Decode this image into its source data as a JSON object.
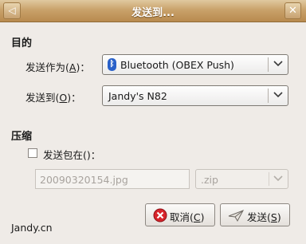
{
  "window": {
    "title": "发送到..."
  },
  "destination": {
    "section_title": "目的",
    "send_as_label_pre": "发送作为(",
    "send_as_mnemonic": "A",
    "send_as_label_post": ")：",
    "send_as_value": "Bluetooth (OBEX Push)",
    "send_to_label_pre": "发送到(",
    "send_to_mnemonic": "O",
    "send_to_label_post": ")：",
    "send_to_value": "Jandy's N82"
  },
  "compression": {
    "section_title": "压缩",
    "pack_label": "发送包在()：",
    "pack_checked": false,
    "filename_value": "20090320154.jpg",
    "format_value": ".zip"
  },
  "buttons": {
    "cancel_pre": "取消(",
    "cancel_mnemonic": "C",
    "cancel_post": ")",
    "send_pre": "发送(",
    "send_mnemonic": "S",
    "send_post": ")"
  },
  "footer": {
    "watermark": "Jandy.cn"
  },
  "colors": {
    "titlebar": "#c9a26b",
    "bluetooth": "#2a61c9",
    "cancel_icon": "#d8242b"
  }
}
